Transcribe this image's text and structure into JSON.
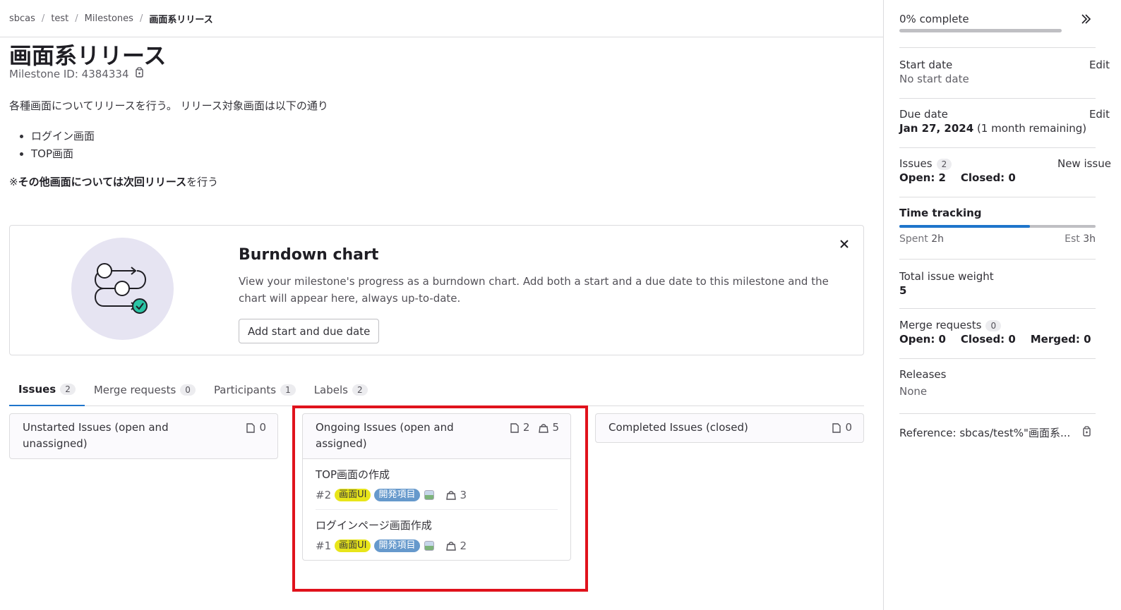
{
  "breadcrumb": [
    "sbcas",
    "test",
    "Milestones",
    "画面系リリース"
  ],
  "breadcrumb_sep": "/",
  "title": "画面系リリース",
  "milestone_id": "Milestone ID: 4384334",
  "description": {
    "intro": "各種画面についてリリースを行う。 リリース対象画面は以下の通り",
    "items": [
      "ログイン画面",
      "TOP画面"
    ],
    "note_prefix": "※",
    "note_bold": "その他画面については次回リリース",
    "note_rest": "を行う"
  },
  "burndown": {
    "title": "Burndown chart",
    "text": "View your milestone's progress as a burndown chart. Add both a start and a due date to this milestone and the chart will appear here, always up-to-date.",
    "button": "Add start and due date"
  },
  "tabs": [
    {
      "label": "Issues",
      "count": "2"
    },
    {
      "label": "Merge requests",
      "count": "0"
    },
    {
      "label": "Participants",
      "count": "1"
    },
    {
      "label": "Labels",
      "count": "2"
    }
  ],
  "columns": {
    "unstarted": {
      "title": "Unstarted Issues (open and unassigned)",
      "issues": "0"
    },
    "ongoing": {
      "title": "Ongoing Issues (open and assigned)",
      "issues": "2",
      "weight": "5"
    },
    "completed": {
      "title": "Completed Issues (closed)",
      "issues": "0"
    }
  },
  "ongoing_issues": [
    {
      "title": "TOP画面の作成",
      "ref": "#2",
      "labels": [
        "画面UI",
        "開発項目"
      ],
      "weight": "3"
    },
    {
      "title": "ログインページ画面作成",
      "ref": "#1",
      "labels": [
        "画面UI",
        "開発項目"
      ],
      "weight": "2"
    }
  ],
  "label_colors": {
    "画面UI": "#e8e51a",
    "開発項目": "#6699cc"
  },
  "sidebar": {
    "progress_text": "0% complete",
    "progress_value": 0,
    "start_date": {
      "label": "Start date",
      "value": "No start date",
      "action": "Edit"
    },
    "due_date": {
      "label": "Due date",
      "value": "Jan 27, 2024",
      "remaining": "(1 month remaining)",
      "action": "Edit"
    },
    "issues": {
      "label": "Issues",
      "count": "2",
      "action": "New issue",
      "open": "Open: 2",
      "closed": "Closed: 0"
    },
    "time_tracking": {
      "label": "Time tracking",
      "spent_label": "Spent",
      "spent": "2h",
      "est_label": "Est",
      "est": "3h",
      "fraction": 0.667
    },
    "weight": {
      "label": "Total issue weight",
      "value": "5"
    },
    "merge_requests": {
      "label": "Merge requests",
      "count": "0",
      "open": "Open: 0",
      "closed": "Closed: 0",
      "merged": "Merged: 0"
    },
    "releases": {
      "label": "Releases",
      "value": "None"
    },
    "reference": "Reference: sbcas/test%\"画面系..."
  },
  "colors": {
    "accent": "#1f75cb",
    "highlight": "#e0121c"
  }
}
